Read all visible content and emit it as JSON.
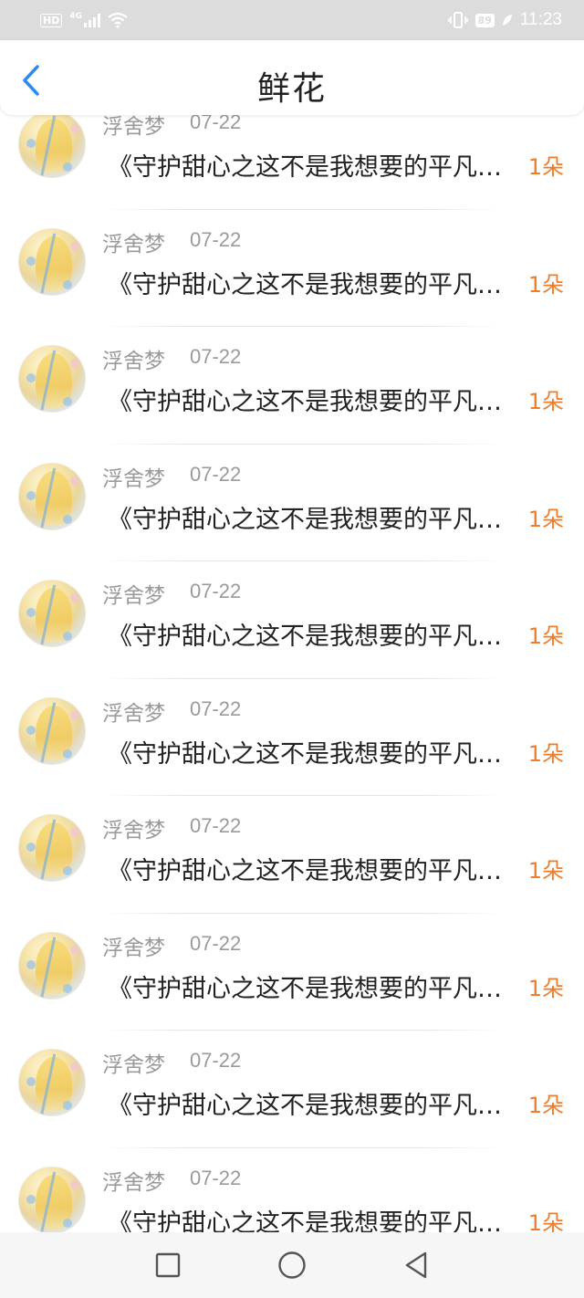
{
  "status_bar": {
    "hd": "HD",
    "network": "4G",
    "battery": "89",
    "time": "11:23"
  },
  "header": {
    "title": "鲜花",
    "back_icon": "chevron-left-icon"
  },
  "items": [
    {
      "username": "浮舍梦",
      "date": "07-22",
      "title": "《守护甜心之这不是我想要的平凡生活》",
      "count": "1朵"
    },
    {
      "username": "浮舍梦",
      "date": "07-22",
      "title": "《守护甜心之这不是我想要的平凡生活》",
      "count": "1朵"
    },
    {
      "username": "浮舍梦",
      "date": "07-22",
      "title": "《守护甜心之这不是我想要的平凡生活》",
      "count": "1朵"
    },
    {
      "username": "浮舍梦",
      "date": "07-22",
      "title": "《守护甜心之这不是我想要的平凡生活》",
      "count": "1朵"
    },
    {
      "username": "浮舍梦",
      "date": "07-22",
      "title": "《守护甜心之这不是我想要的平凡生活》",
      "count": "1朵"
    },
    {
      "username": "浮舍梦",
      "date": "07-22",
      "title": "《守护甜心之这不是我想要的平凡生活》",
      "count": "1朵"
    },
    {
      "username": "浮舍梦",
      "date": "07-22",
      "title": "《守护甜心之这不是我想要的平凡生活》",
      "count": "1朵"
    },
    {
      "username": "浮舍梦",
      "date": "07-22",
      "title": "《守护甜心之这不是我想要的平凡生活》",
      "count": "1朵"
    },
    {
      "username": "浮舍梦",
      "date": "07-22",
      "title": "《守护甜心之这不是我想要的平凡生活》",
      "count": "1朵"
    },
    {
      "username": "浮舍梦",
      "date": "07-22",
      "title": "《守护甜心之这不是我想要的平凡生活》",
      "count": "1朵"
    }
  ],
  "nav_bar": {
    "icons": [
      "square-icon",
      "circle-icon",
      "triangle-back-icon"
    ]
  },
  "colors": {
    "accent": "#f07c2a",
    "back_arrow": "#2d8cf0",
    "status_bar": "#dcdcdc"
  }
}
